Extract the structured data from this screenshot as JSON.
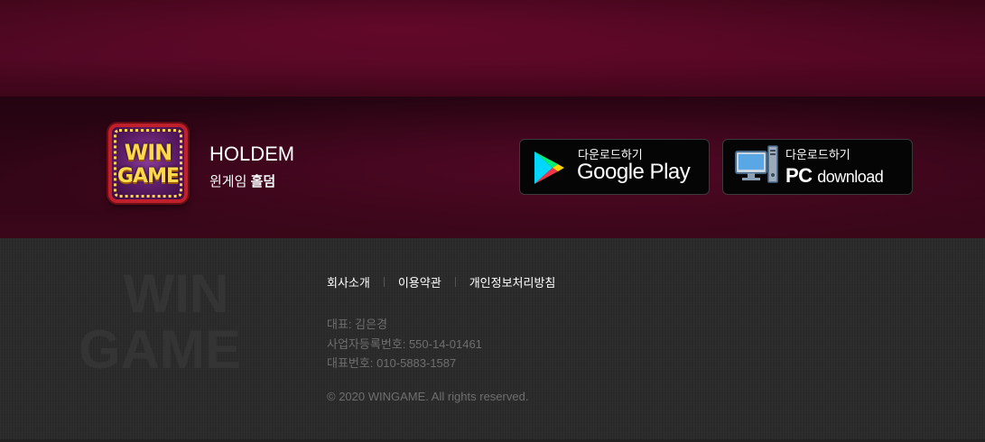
{
  "brand": {
    "logo_line1": "WIN",
    "logo_line2": "GAME",
    "title": "HOLDEM",
    "subtitle_prefix": "윈게임 ",
    "subtitle_bold": "홀덤"
  },
  "downloads": {
    "google": {
      "caption": "다운로드하기",
      "label": "Google Play"
    },
    "pc": {
      "caption": "다운로드하기",
      "label_bold": "PC",
      "label_light": "download"
    }
  },
  "watermark": {
    "line1": "WIN",
    "line2": "GAME"
  },
  "footer": {
    "links": [
      "회사소개",
      "이용약관",
      "개인정보처리방침"
    ],
    "ceo": "대표: 김은경",
    "business_number": "사업자등록번호: 550-14-01461",
    "phone": "대표번호: 010-5883-1587",
    "copyright": "© 2020 WINGAME. All rights reserved."
  },
  "colors": {
    "maroon": "#4d0822",
    "dark_maroon": "#240410",
    "footer_bg": "#2a2a2a",
    "logo_gold": "#ffd94a",
    "logo_border": "#c0202c"
  }
}
